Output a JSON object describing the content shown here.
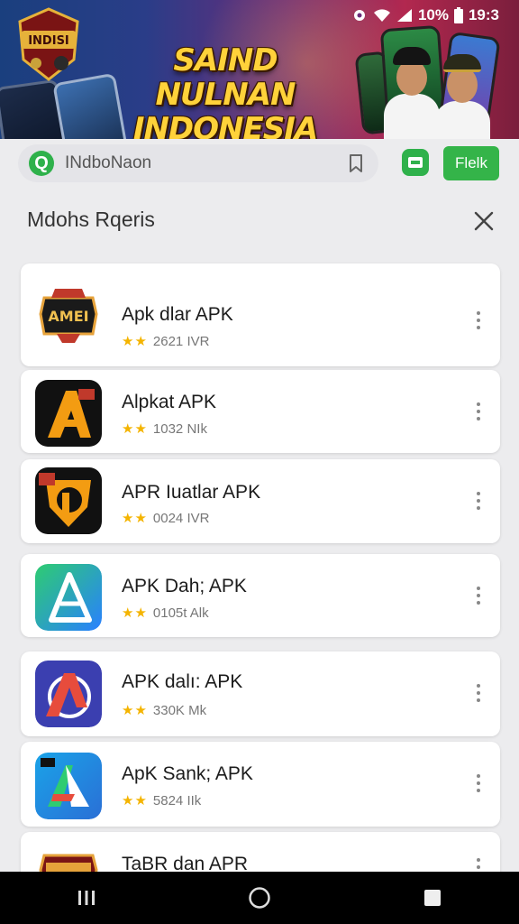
{
  "status_bar": {
    "battery_percent": "10%",
    "time": "19:3"
  },
  "banner": {
    "title_line1": "SAIND NULNAN",
    "title_line2": "INDONESIA",
    "logo_text": "INDISI",
    "colors": {
      "title": "#ffd23a",
      "bg_left": "#1a3f7e",
      "bg_right": "#b2284f"
    }
  },
  "search": {
    "value": "INdboNaon",
    "logo_letter": "Q",
    "action_label": "Flelk",
    "accent": "#2fb14b"
  },
  "section": {
    "title": "Mdohs Rqeris"
  },
  "apps": [
    {
      "name": "Apk dlar APK",
      "stars": "★★",
      "meta": "2621 IVR",
      "icon": "amei-badge-icon"
    },
    {
      "name": "Alpkat APK",
      "stars": "★★",
      "meta": "1032 NIk",
      "icon": "letter-a-orange-icon"
    },
    {
      "name": "APR Iuatlar APK",
      "stars": "★★",
      "meta": "0024 IVR",
      "icon": "shield-p-icon"
    },
    {
      "name": "APK Dah; APK",
      "stars": "★★",
      "meta": "0105t Alk",
      "icon": "blue-a-triangle-icon"
    },
    {
      "name": "APK dalı: APK",
      "stars": "★★",
      "meta": "330K Mk",
      "icon": "red-a-circle-icon"
    },
    {
      "name": "ApK Sank; APK",
      "stars": "★★",
      "meta": "5824 IIk",
      "icon": "colorful-a-icon"
    },
    {
      "name": "TaBR dan APR",
      "stars": "",
      "meta": "",
      "icon": "badge-partial-icon"
    }
  ],
  "nav": {
    "recents": "recents-icon",
    "home": "home-icon",
    "back": "back-icon"
  }
}
